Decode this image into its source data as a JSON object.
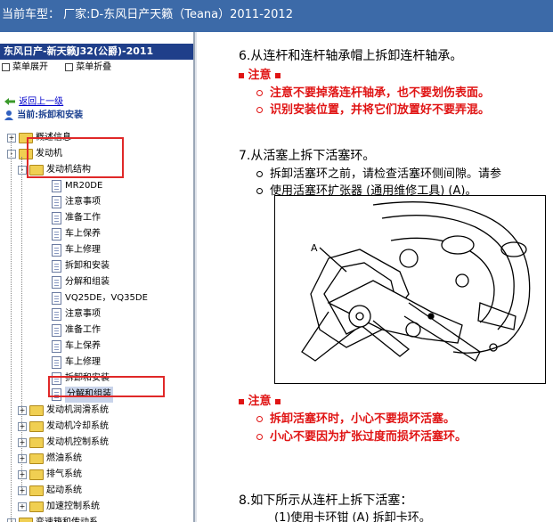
{
  "window": {
    "title": "当前车型：  厂家:D-东风日产天籁（Teana）2011-2012"
  },
  "sidebar": {
    "header": "东风日产-新天籁J32(公爵)-2011",
    "expand_label": "菜单展开",
    "collapse_label": "菜单折叠",
    "back_label": "返回上一级",
    "current_label": "当前:拆卸和安装",
    "tree": [
      {
        "label": "概述信息",
        "type": "folder",
        "level": 1,
        "expander": "+"
      },
      {
        "label": "发动机",
        "type": "folder",
        "level": 1,
        "expander": "-"
      },
      {
        "label": "发动机结构",
        "type": "folder",
        "level": 2,
        "expander": "-"
      },
      {
        "label": "MR20DE",
        "type": "doc",
        "level": 3
      },
      {
        "label": "注意事项",
        "type": "doc",
        "level": 3
      },
      {
        "label": "准备工作",
        "type": "doc",
        "level": 3
      },
      {
        "label": "车上保养",
        "type": "doc",
        "level": 3
      },
      {
        "label": "车上修理",
        "type": "doc",
        "level": 3
      },
      {
        "label": "拆卸和安装",
        "type": "doc",
        "level": 3
      },
      {
        "label": "分解和组装",
        "type": "doc",
        "level": 3
      },
      {
        "label": "VQ25DE，VQ35DE",
        "type": "doc",
        "level": 3
      },
      {
        "label": "注意事项",
        "type": "doc",
        "level": 3
      },
      {
        "label": "准备工作",
        "type": "doc",
        "level": 3
      },
      {
        "label": "车上保养",
        "type": "doc",
        "level": 3
      },
      {
        "label": "车上修理",
        "type": "doc",
        "level": 3
      },
      {
        "label": "拆卸和安装",
        "type": "doc",
        "level": 3
      },
      {
        "label": "分解和组装",
        "type": "doc",
        "level": 3,
        "selected": true
      },
      {
        "label": "发动机润滑系统",
        "type": "folder",
        "level": 2,
        "expander": "+"
      },
      {
        "label": "发动机冷却系统",
        "type": "folder",
        "level": 2,
        "expander": "+"
      },
      {
        "label": "发动机控制系统",
        "type": "folder",
        "level": 2,
        "expander": "+"
      },
      {
        "label": "燃油系统",
        "type": "folder",
        "level": 2,
        "expander": "+"
      },
      {
        "label": "排气系统",
        "type": "folder",
        "level": 2,
        "expander": "+"
      },
      {
        "label": "起动系统",
        "type": "folder",
        "level": 2,
        "expander": "+"
      },
      {
        "label": "加速控制系统",
        "type": "folder",
        "level": 2,
        "expander": "+"
      },
      {
        "label": "变速箱和传动系",
        "type": "folder",
        "level": 1,
        "expander": "+"
      }
    ]
  },
  "content": {
    "step6_title": "6.从连杆和连杆轴承帽上拆卸连杆轴承。",
    "caution1_label": "注意",
    "caution1_items": [
      "注意不要掉落连杆轴承，也不要划伤表面。",
      "识别安装位置，并将它们放置好不要弄混。"
    ],
    "step7_title": "7.从活塞上拆下活塞环。",
    "step7_items": [
      "拆卸活塞环之前，请检查活塞环侧间隙。请参",
      "使用活塞环扩张器 (通用维修工具) (A)。"
    ],
    "figure_label_a": "A",
    "caution2_label": "注意",
    "caution2_items": [
      "拆卸活塞环时，小心不要损坏活塞。",
      "小心不要因为扩张过度而损坏活塞环。"
    ],
    "step8_title": "8.如下所示从连杆上拆下活塞：",
    "step8_sub": "(1)使用卡环钳 (A) 拆卸卡环。"
  }
}
